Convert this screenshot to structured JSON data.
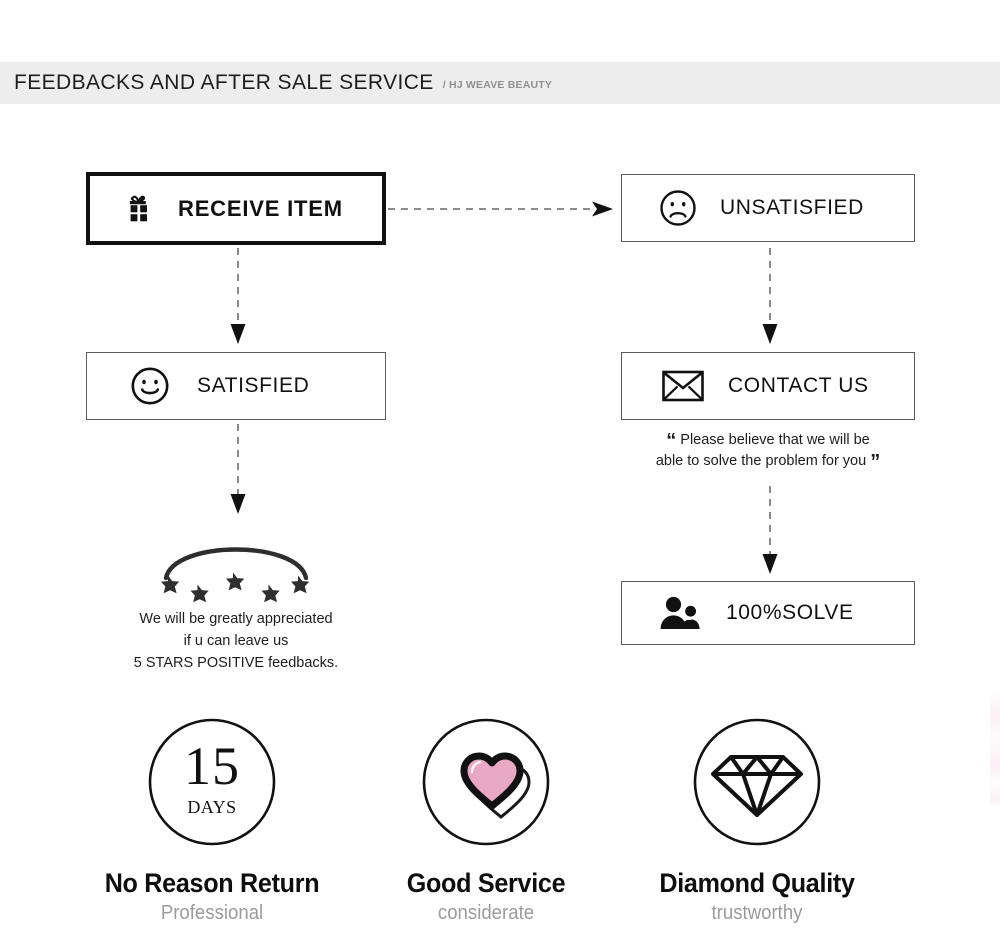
{
  "header": {
    "title": "FEEDBACKS AND AFTER SALE SERVICE",
    "subtitle": "/ HJ WEAVE BEAUTY",
    "background": "#ededed"
  },
  "flow": {
    "receive": {
      "label": "RECEIVE ITEM",
      "icon": "gift-icon"
    },
    "unsatisfied": {
      "label": "UNSATISFIED",
      "icon": "sad-face-icon"
    },
    "satisfied": {
      "label": "SATISFIED",
      "icon": "happy-face-icon"
    },
    "contact": {
      "label": "CONTACT US",
      "icon": "envelope-icon"
    },
    "solve": {
      "label": "100%SOLVE",
      "icon": "people-icon"
    }
  },
  "quote": {
    "open_mark": "“",
    "line1": "Please believe that we will be",
    "line2": "able to solve the problem for you",
    "close_mark": "”"
  },
  "stars": {
    "count": 5,
    "caption_line1": "We will be greatly appreciated",
    "caption_line2": "if u can leave us",
    "caption_line3": "5 STARS POSITIVE feedbacks."
  },
  "badges": [
    {
      "icon": "calendar-15-days-icon",
      "number": "15",
      "unit": "DAYS",
      "title": "No Reason Return",
      "subtitle": "Professional"
    },
    {
      "icon": "heart-icon",
      "title": "Good Service",
      "subtitle": "considerate",
      "accent": "#e9a8c4"
    },
    {
      "icon": "diamond-icon",
      "title": "Diamond Quality",
      "subtitle": "trustworthy"
    }
  ]
}
